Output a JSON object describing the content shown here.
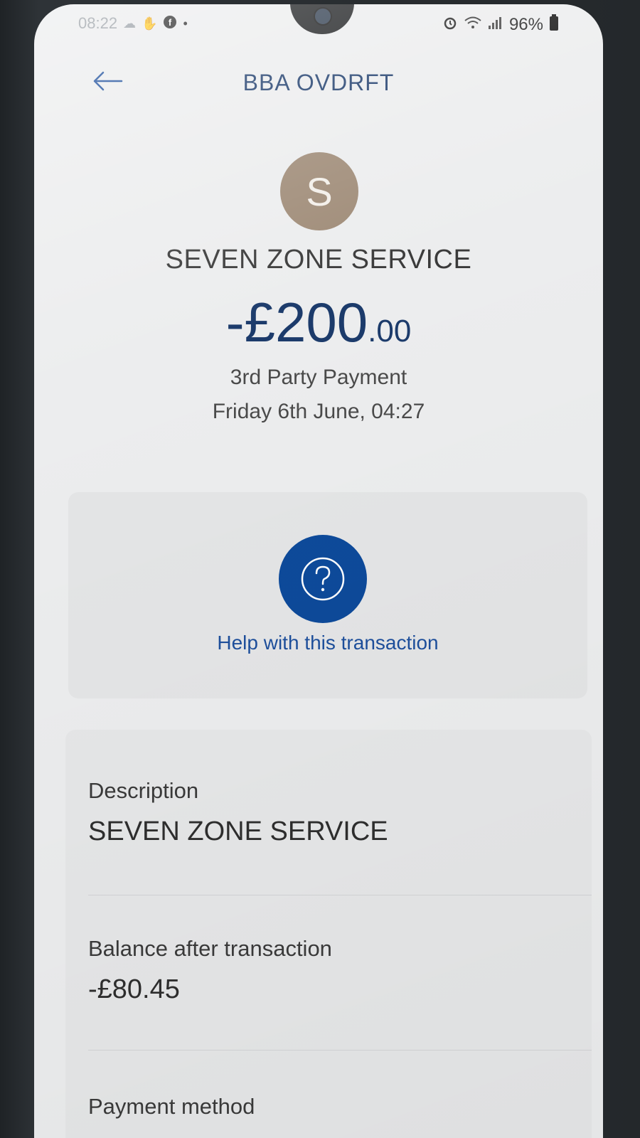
{
  "status_bar": {
    "time": "08:22",
    "battery_percent": "96%",
    "left_icons": [
      "cloud-icon",
      "hand-icon",
      "facebook-icon",
      "dot-icon"
    ],
    "right_icons": [
      "alarm-icon",
      "wifi-icon",
      "signal-icon",
      "battery-icon"
    ]
  },
  "header": {
    "title": "BBA OVDRFT",
    "back_icon": "back-arrow-icon"
  },
  "transaction": {
    "avatar_letter": "S",
    "merchant": "SEVEN ZONE SERVICE",
    "amount_main": "-£200",
    "amount_pence": ".00",
    "type": "3rd Party Payment",
    "date": "Friday 6th June, 04:27"
  },
  "help": {
    "icon": "question-icon",
    "link_label": "Help with this transaction"
  },
  "details": [
    {
      "label": "Description",
      "value": "SEVEN ZONE SERVICE"
    },
    {
      "label": "Balance after transaction",
      "value": "-£80.45"
    },
    {
      "label": "Payment method",
      "value": ""
    }
  ],
  "colors": {
    "primary_blue": "#0d4a9a",
    "title_navy": "#1c3b6b",
    "avatar_bg": "#9e8a76",
    "screen_bg": "#ecedee"
  }
}
